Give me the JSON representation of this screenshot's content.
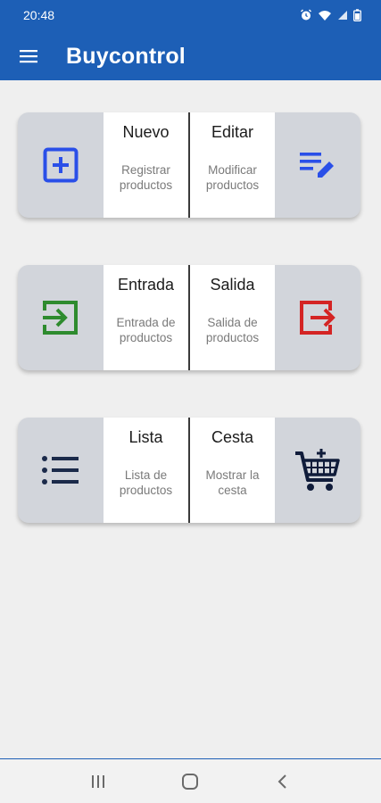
{
  "status_bar": {
    "time": "20:48"
  },
  "app_bar": {
    "title": "Buycontrol"
  },
  "colors": {
    "primary": "#1d5fb6",
    "add_icon": "#2a4fe8",
    "edit_icon": "#2a4fe8",
    "entry_icon": "#2e8b2e",
    "exit_icon": "#d42424",
    "list_icon": "#1b2a4a",
    "cart_icon": "#101c3a"
  },
  "cards": [
    {
      "left_icon": "add-box-icon",
      "right_icon": "edit-list-icon",
      "left_cell": {
        "title": "Nuevo",
        "subtitle": "Registrar productos"
      },
      "right_cell": {
        "title": "Editar",
        "subtitle": "Modificar productos"
      }
    },
    {
      "left_icon": "login-icon",
      "right_icon": "logout-icon",
      "left_cell": {
        "title": "Entrada",
        "subtitle": "Entrada de productos"
      },
      "right_cell": {
        "title": "Salida",
        "subtitle": "Salida de productos"
      }
    },
    {
      "left_icon": "list-icon",
      "right_icon": "shopping-cart-icon",
      "left_cell": {
        "title": "Lista",
        "subtitle": "Lista de productos"
      },
      "right_cell": {
        "title": "Cesta",
        "subtitle": "Mostrar la cesta"
      }
    }
  ],
  "nav_bar": {
    "buttons": [
      "recents-icon",
      "home-icon",
      "back-icon"
    ]
  }
}
